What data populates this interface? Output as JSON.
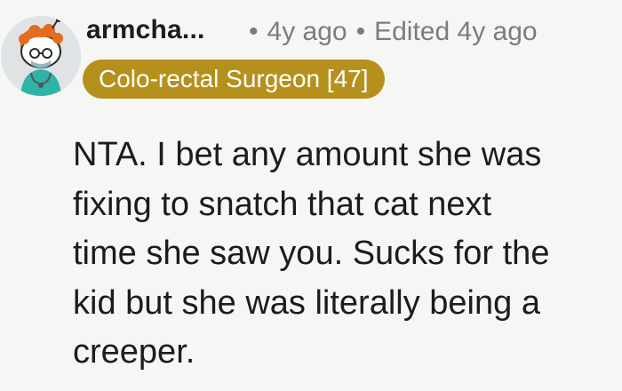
{
  "comment": {
    "username": "armcha...",
    "separator": "•",
    "posted": "4y ago",
    "edited": "Edited 4y ago",
    "flair": "Colo-rectal Surgeon [47]",
    "flair_color": "#b6901d",
    "body_lines": [
      "NTA. I bet any amount she was",
      "fixing to snatch that cat next",
      "time she saw you. Sucks for the",
      "kid but she was literally being a",
      "creeper."
    ]
  }
}
